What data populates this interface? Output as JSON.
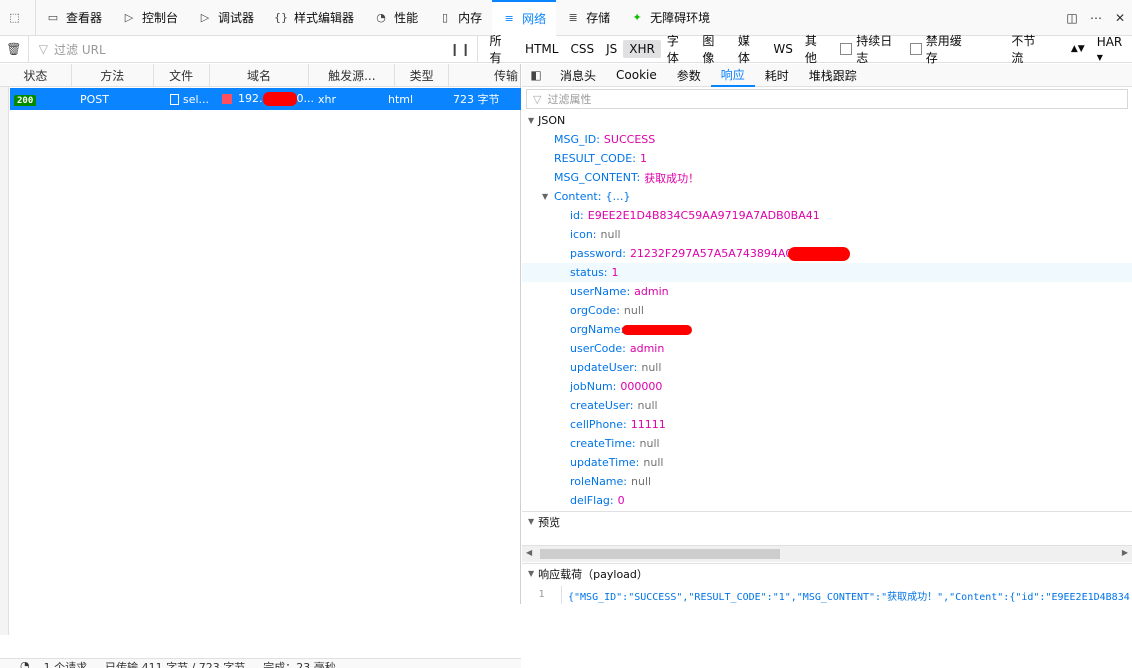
{
  "toolbar": {
    "tools": [
      {
        "label": "查看器",
        "icon": "inspector-icon"
      },
      {
        "label": "控制台",
        "icon": "console-icon"
      },
      {
        "label": "调试器",
        "icon": "debugger-icon"
      },
      {
        "label": "样式编辑器",
        "icon": "style-editor-icon"
      },
      {
        "label": "性能",
        "icon": "performance-icon"
      },
      {
        "label": "内存",
        "icon": "memory-icon"
      },
      {
        "label": "网络",
        "icon": "network-icon"
      },
      {
        "label": "存储",
        "icon": "storage-icon"
      },
      {
        "label": "无障碍环境",
        "icon": "accessibility-icon"
      }
    ],
    "active": "网络"
  },
  "filterbar": {
    "url_placeholder": "过滤 URL",
    "types": [
      "所有",
      "HTML",
      "CSS",
      "JS",
      "XHR",
      "字体",
      "图像",
      "媒体",
      "WS",
      "其他"
    ],
    "active_type": "XHR",
    "persist_logs": "持续日志",
    "disable_cache": "禁用缓存",
    "throttle": "不节流",
    "har": "HAR"
  },
  "columns": [
    "状态",
    "方法",
    "文件",
    "域名",
    "触发源...",
    "类型",
    "传输"
  ],
  "request": {
    "status": "200",
    "method": "POST",
    "file": "sel...",
    "domain_prefix": "192.",
    "domain_suffix": "0...",
    "cause": "xhr",
    "type": "html",
    "transferred": "723 字节"
  },
  "footer": {
    "requests": "1 个请求",
    "transferred": "已传输 411 字节 / 723 字节",
    "finish": "完成：23 毫秒"
  },
  "detail_tabs": [
    "消息头",
    "Cookie",
    "参数",
    "响应",
    "耗时",
    "堆栈跟踪"
  ],
  "active_detail_tab": "响应",
  "prop_filter_placeholder": "过滤属性",
  "json_section": "JSON",
  "preview_section": "预览",
  "payload_section": "响应载荷（payload）",
  "json_top": [
    {
      "key": "MSG_ID:",
      "value": "SUCCESS",
      "kind": "str"
    },
    {
      "key": "RESULT_CODE:",
      "value": "1",
      "kind": "str"
    },
    {
      "key": "MSG_CONTENT:",
      "value": "获取成功！",
      "kind": "str"
    }
  ],
  "content_key": "Content:",
  "content_brace": "{…}",
  "content_fields": [
    {
      "key": "id:",
      "value": "E9EE2E1D4B834C59AA9719A7ADB0BA41",
      "kind": "str"
    },
    {
      "key": "icon:",
      "value": "null",
      "kind": "null"
    },
    {
      "key": "password:",
      "value": "21232F297A57A5A743894A0",
      "kind": "str"
    },
    {
      "key": "status:",
      "value": "1",
      "kind": "str"
    },
    {
      "key": "userName:",
      "value": "admin",
      "kind": "str"
    },
    {
      "key": "orgCode:",
      "value": "null",
      "kind": "null"
    },
    {
      "key": "orgName:",
      "value": "",
      "kind": "str"
    },
    {
      "key": "userCode:",
      "value": "admin",
      "kind": "str"
    },
    {
      "key": "updateUser:",
      "value": "null",
      "kind": "null"
    },
    {
      "key": "jobNum:",
      "value": "000000",
      "kind": "str"
    },
    {
      "key": "createUser:",
      "value": "null",
      "kind": "null"
    },
    {
      "key": "cellPhone:",
      "value": "11111",
      "kind": "str"
    },
    {
      "key": "createTime:",
      "value": "null",
      "kind": "null"
    },
    {
      "key": "updateTime:",
      "value": "null",
      "kind": "null"
    },
    {
      "key": "roleName:",
      "value": "null",
      "kind": "null"
    },
    {
      "key": "delFlag:",
      "value": "0",
      "kind": "str"
    }
  ],
  "payload": {
    "line_number": "1",
    "code": "{\"MSG_ID\":\"SUCCESS\",\"RESULT_CODE\":\"1\",\"MSG_CONTENT\":\"获取成功！\",\"Content\":{\"id\":\"E9EE2E1D4B834"
  }
}
